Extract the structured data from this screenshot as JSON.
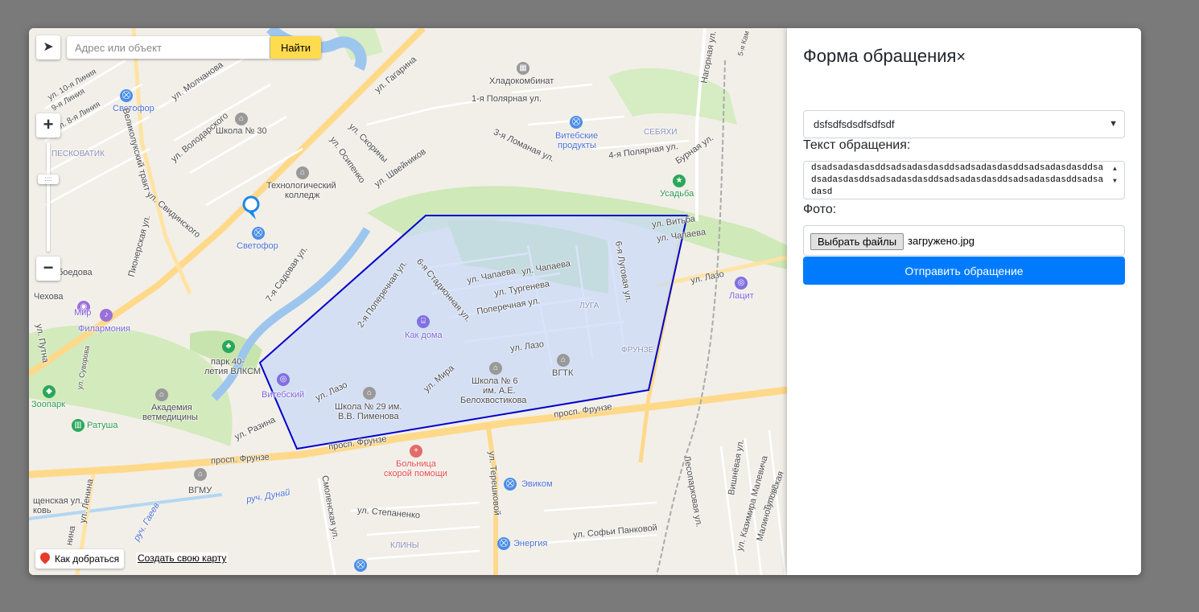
{
  "map": {
    "search_placeholder": "Адрес или объект",
    "search_button": "Найти",
    "route_link": "Как добраться",
    "create_map_link": "Создать свою карту",
    "labels": {
      "holodokombinat": "Хладокомбинат",
      "school30": "Школа № 30",
      "svetofor_top": "Светофор",
      "svetofor_mid": "Светофор",
      "techcollege_1": "Технологический",
      "techcollege_2": "колледж",
      "vitebskie_1": "Витебские",
      "vitebskie_2": "продукты",
      "sebyahi": "СЕБЯХИ",
      "usadba": "Усадьба",
      "peskovatik": "ПЕСКОВАТИК",
      "gagarina": "ул. Гагарина",
      "polyarnaya1": "1-я Полярная ул.",
      "polyarnaya4": "4-я Полярная ул.",
      "lomanaya3": "3-я Ломаная ул.",
      "chapaeva1": "ул. Чапаева",
      "chapaeva2": "ул. Чапаева",
      "turgeneva": "ул. Тургенева",
      "poperechnaya": "Поперечная ул.",
      "luga": "ЛУГА",
      "lazo1": "ул. Лазо",
      "lazo2": "ул. Лазо",
      "lazo3": "ул. Лазо",
      "kak_doma": "Как дома",
      "vgtk": "ВГТК",
      "school6_1": "Школа № 6",
      "school6_2": "им. А.Е.",
      "school6_3": "Белохвостикова",
      "school29_1": "Школа № 29 им.",
      "school29_2": "В.В. Пименова",
      "vitebsky": "Витебский",
      "frunze_dist": "ФРУНЗЕ",
      "prosp_frunze1": "просп. Фрунзе",
      "prosp_frunze2": "просп. Фрунзе",
      "prosp_frunze3": "просп. Фрунзе",
      "hospital_1": "Больница",
      "hospital_2": "скорой помощи",
      "evikom": "Эвиком",
      "energia": "Энергия",
      "klinы": "КЛИНЫ",
      "park_1": "парк 40-",
      "park_2": "летия ВЛКСМ",
      "mir": "Мир",
      "filarmonia": "Филармония",
      "zoopark": "Зоопарк",
      "ratusha": "Ратуша",
      "academy_1": "Академия",
      "academy_2": "ветмедицины",
      "vgmu": "ВГМУ",
      "lenina": "ул. Ленина",
      "razina": "ул. Разина",
      "mira": "ул. Мира",
      "tereshkovoi": "ул. Терешковой",
      "smolenskaya": "Смоленская ул.",
      "stepanenko": "ул. Степаненко",
      "sofii": "ул. Софьи Панковой",
      "lacit": "Лацит",
      "vitba": "ул. Витьба",
      "chapaeva_r": "ул. Чапаева",
      "sadovaya": "7-я Садовая ул.",
      "stadionnaya": "6-я Стадионная ул.",
      "poperechnaya2": "2-я Поперечная ул.",
      "lugovaya": "6-я Луговая ул.",
      "skoriny": "ул. Скорины",
      "osipenko": "ул. Осипенко",
      "shveynikov": "ул. Швейников",
      "volodarskogo": "ул. Володарского",
      "svidinskogo": "ул. Свидинского",
      "molchanova": "ул. Молчанова",
      "velikoluksky": "Великолукский тракт",
      "pionerskaya": "Пионерская ул.",
      "bursnaya": "Бурная ул.",
      "nagornaya": "Нагорная ул.",
      "boedova": "боедова",
      "chehova": "Чехова",
      "putna": "ул. Путна",
      "suvorova": "ул. Суворова",
      "duna": "руч. Дунай",
      "gaeev": "руч. Гаеев",
      "lesoparkovaya": "Лесопарковая ул.",
      "vishnevaya": "Вишнёвая ул.",
      "malevicha": "ул. Казимира Малевича",
      "malinovaya": "Малиновая ул.",
      "tupovskaya": "Туповская",
      "liniya10": "ул. 10-я Линия",
      "liniya9": "9-я Линия",
      "liniya8": "ул. 8-я Линия",
      "shenskaya": "щенская ул.",
      "kov": "ковь",
      "nina": "нина",
      "fifth": "5-я Кам"
    }
  },
  "form": {
    "title": "Форма обращения",
    "close_symbol": "×",
    "select_value": "dsfsdfsdsdfsdfsdf",
    "text_label": "Текст обращения:",
    "text_value": "dsadsadasdasddsadsadasdasddsadsadasdasddsadsadasdasddsadsadasdasddsadsadasdasddsadsadasdasddsadsadasdasddsadsadasd",
    "photo_label": "Фото:",
    "file_button": "Выбрать файлы",
    "file_name": "загружено.jpg",
    "submit": "Отправить обращение"
  },
  "colors": {
    "accent": "#007bff",
    "search_button": "#ffdb4d",
    "polygon_stroke": "#0000cc",
    "polygon_fill": "#c8d8f8"
  }
}
